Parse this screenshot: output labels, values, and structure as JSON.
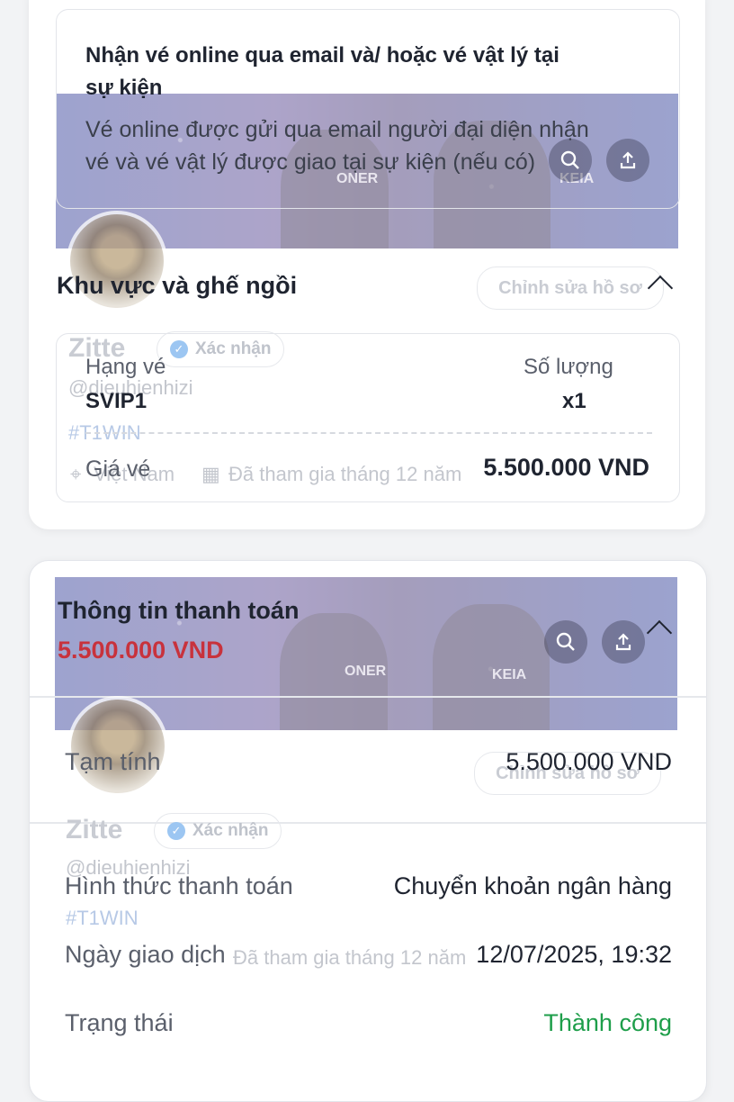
{
  "delivery": {
    "title": "Nhận vé online qua email và/ hoặc vé vật lý tại sự kiện",
    "title_line1": "Nhận vé online qua email và/ hoặc vé vật lý tại",
    "title_line2": "sự kiện",
    "desc_line1": "Vé online được gửi qua email người đại diện nhận",
    "desc_line2": "vé và vé vật lý được giao tại sự kiện (nếu có)"
  },
  "seating": {
    "title": "Khu vực và ghế ngồi",
    "ticket_class_label": "Hạng vé",
    "ticket_class_value": "SVIP1",
    "quantity_label": "Số lượng",
    "quantity_value": "x1",
    "price_label": "Giá vé",
    "price_value": "5.500.000 VND"
  },
  "payment": {
    "title": "Thông tin thanh toán",
    "total": "5.500.000 VND",
    "subtotal_label": "Tạm tính",
    "subtotal_value": "5.500.000 VND",
    "method_label": "Hình thức thanh toán",
    "method_value": "Chuyển khoản ngân hàng",
    "date_label": "Ngày giao dịch",
    "date_value": "12/07/2025, 19:32",
    "status_label": "Trạng thái",
    "status_value": "Thành công"
  },
  "overlay_profile": {
    "edit_profile": "Chỉnh sửa hồ sơ",
    "name": "Zitte",
    "verified": "Xác nhận",
    "handle": "@dieuhienhizi",
    "hashtag": "#T1WIN",
    "location": "Việt Nam",
    "joined": "Đã tham gia tháng 12 năm",
    "jersey_1": "ONER",
    "jersey_2": "KEIA"
  },
  "colors": {
    "total_red": "#c8323c",
    "success_green": "#1e9e4a",
    "text_dark": "#1f2430",
    "text_muted": "#5a5f6b"
  },
  "icons": [
    "search-icon",
    "share-icon",
    "chevron-up-icon",
    "location-icon",
    "calendar-icon",
    "verified-check-icon"
  ]
}
